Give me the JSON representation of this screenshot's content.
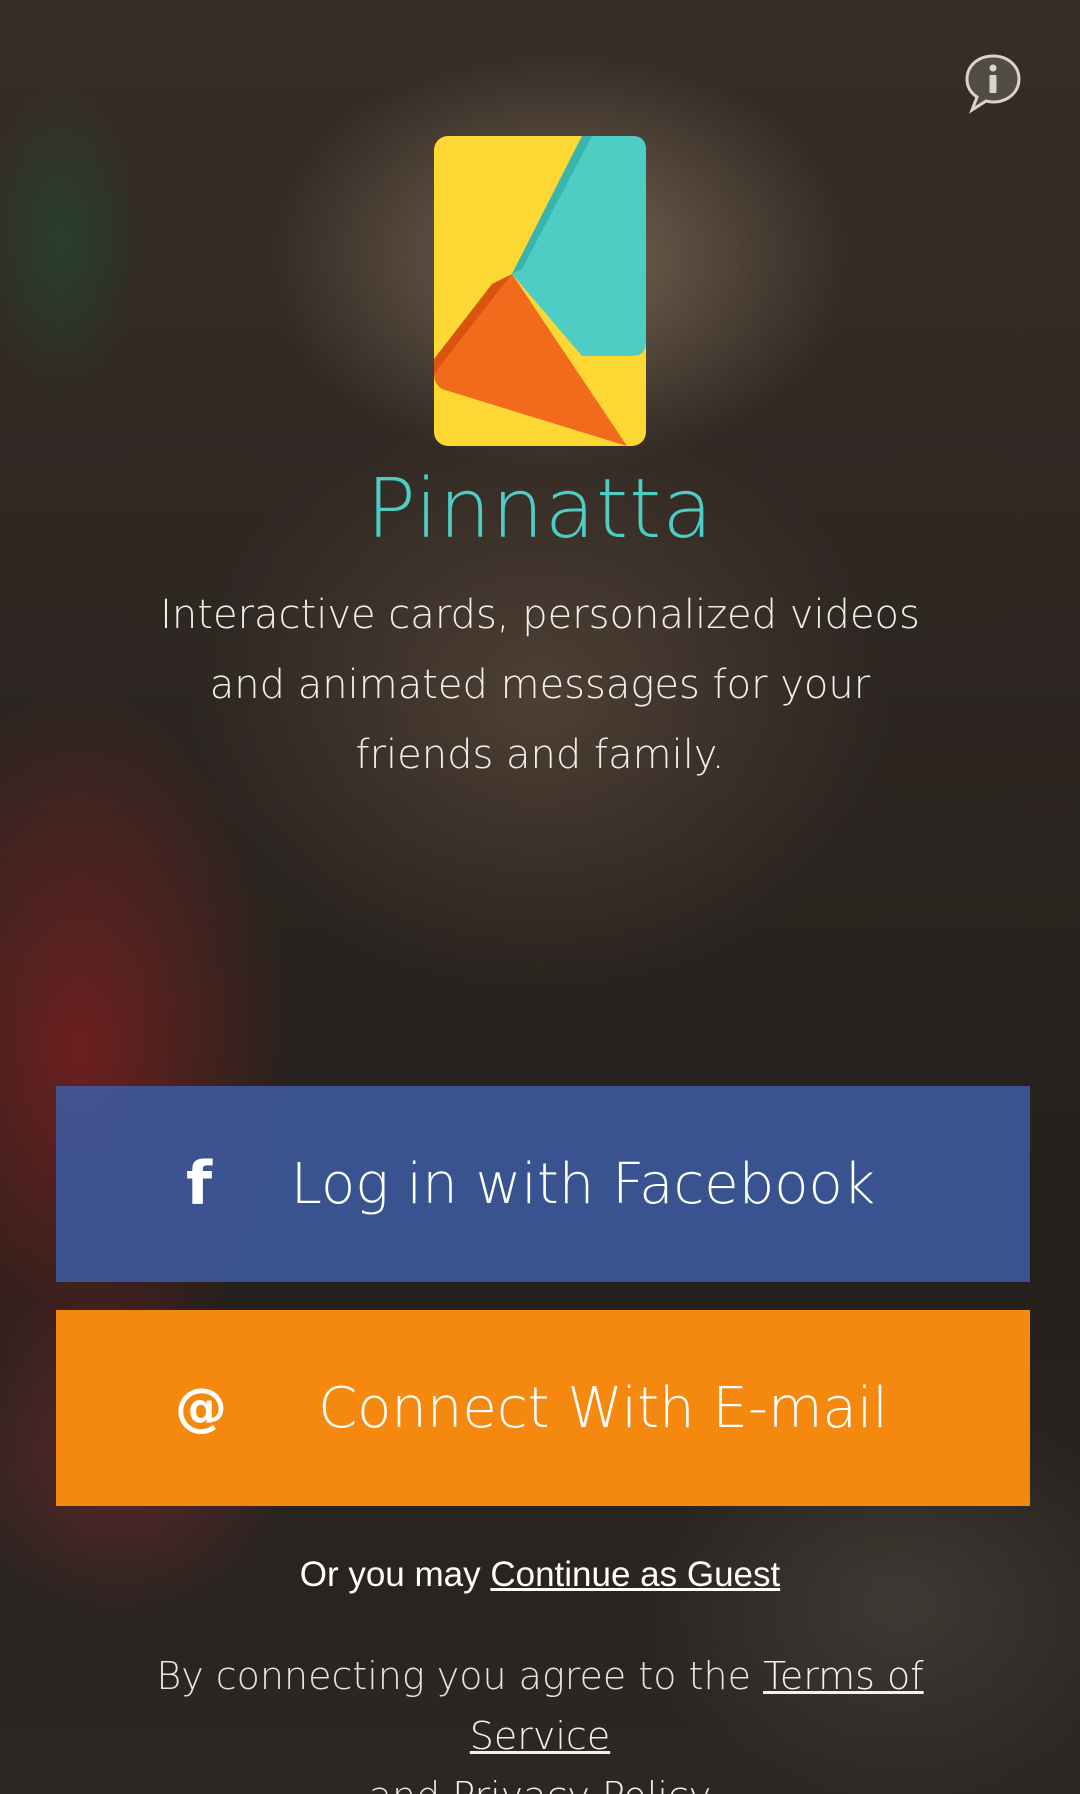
{
  "app": {
    "title": "Pinnatta",
    "tagline": "Interactive cards, personalized videos and animated messages for your friends and family."
  },
  "header": {
    "info_icon": "info-speech-bubble-icon"
  },
  "logo": {
    "icon": "pinnatta-logo",
    "colors": {
      "yellow": "#FDD835",
      "teal": "#4ECDC4",
      "orange": "#F26A1B"
    }
  },
  "buttons": {
    "facebook": {
      "label": "Log in with Facebook",
      "icon": "facebook-icon",
      "icon_glyph": "f",
      "color": "#3C5AA0"
    },
    "email": {
      "label": "Connect With E-mail",
      "icon": "at-sign-icon",
      "icon_glyph": "@",
      "color": "#F5890F"
    }
  },
  "guest": {
    "prefix": "Or you may ",
    "link": "Continue as Guest"
  },
  "legal": {
    "prefix": "By connecting you agree to the ",
    "terms_link": "Terms of Service",
    "middle": "and ",
    "privacy_link": "Privacy Policy"
  },
  "colors": {
    "title": "#4ECDC4",
    "text": "#FFFFFF"
  }
}
